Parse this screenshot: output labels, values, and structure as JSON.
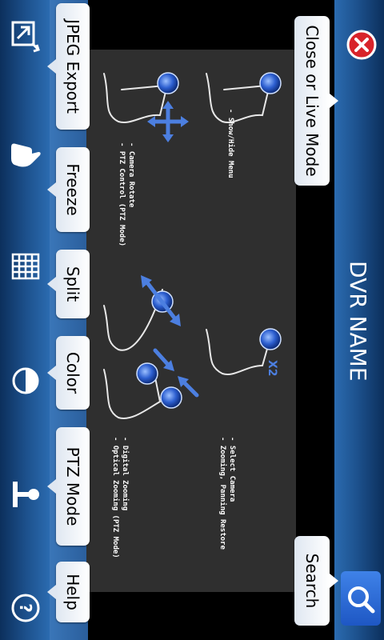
{
  "title": "DVR NAME",
  "buttons": {
    "close_live": "Close or Live Mode",
    "search": "Search",
    "jpeg_export": "JPEG Export",
    "freeze": "Freeze",
    "split": "Split",
    "color": "Color",
    "ptz_mode": "PTZ Mode",
    "help": "Help"
  },
  "hints": {
    "show_hide": "- Show/Hide Menu",
    "select_camera": "- Select Camera",
    "zoom_pan_restore": "- Zooming, Panning Restore",
    "x2": "X2",
    "camera_rotate": "- Camera Rotate",
    "ptz_control": "- PTZ Control (PTZ Mode)",
    "digital_zoom": "- Digital Zooming",
    "optical_zoom": "- Optical Zooming (PTZ Mode)"
  },
  "colors": {
    "bar_dark": "#0c2f5c",
    "bar_light": "#2b6bb0",
    "close_red": "#d8232a",
    "search_blue": "#2f6fd8",
    "arrow_blue": "#4c7fe0"
  },
  "icons": [
    "export-icon",
    "hand-icon",
    "grid-icon",
    "contrast-icon",
    "ptz-joystick-icon",
    "help-question-icon",
    "close-icon",
    "search-icon",
    "touch-gesture-illustration"
  ]
}
